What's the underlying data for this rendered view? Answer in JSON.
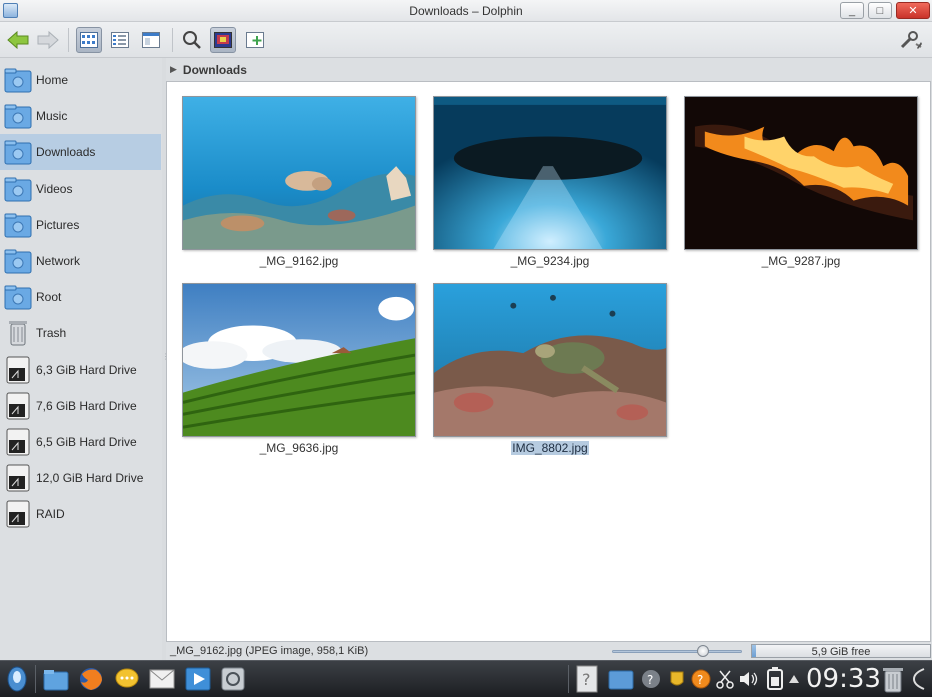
{
  "window": {
    "title": "Downloads – Dolphin",
    "min_label": "_",
    "max_label": "□",
    "close_label": "✕"
  },
  "toolbar": {
    "buttons": [
      {
        "name": "back-button",
        "icon": "back-arrow-icon"
      },
      {
        "name": "forward-button",
        "icon": "forward-arrow-icon"
      },
      {
        "name": "icons-view-button",
        "icon": "icons-view-icon",
        "active": true
      },
      {
        "name": "details-view-button",
        "icon": "details-view-icon"
      },
      {
        "name": "split-view-button",
        "icon": "split-view-icon"
      },
      {
        "name": "search-button",
        "icon": "search-icon"
      },
      {
        "name": "preview-button",
        "icon": "preview-icon",
        "active": true
      },
      {
        "name": "new-tab-button",
        "icon": "new-tab-icon"
      },
      {
        "name": "configure-button",
        "icon": "wrench-icon"
      }
    ]
  },
  "places": {
    "items": [
      {
        "label": "Home",
        "icon": "home-folder-icon"
      },
      {
        "label": "Music",
        "icon": "music-folder-icon"
      },
      {
        "label": "Downloads",
        "icon": "downloads-folder-icon",
        "selected": true
      },
      {
        "label": "Videos",
        "icon": "videos-folder-icon"
      },
      {
        "label": "Pictures",
        "icon": "pictures-folder-icon"
      },
      {
        "label": "Network",
        "icon": "network-folder-icon"
      },
      {
        "label": "Root",
        "icon": "root-folder-icon"
      },
      {
        "label": "Trash",
        "icon": "trash-icon"
      },
      {
        "label": "6,3 GiB Hard Drive",
        "icon": "hard-drive-icon"
      },
      {
        "label": "7,6 GiB Hard Drive",
        "icon": "hard-drive-icon"
      },
      {
        "label": "6,5 GiB Hard Drive",
        "icon": "hard-drive-icon"
      },
      {
        "label": "12,0 GiB Hard Drive",
        "icon": "hard-drive-icon"
      },
      {
        "label": "RAID",
        "icon": "hard-drive-icon"
      }
    ]
  },
  "breadcrumb": {
    "current": "Downloads"
  },
  "files": [
    {
      "name": "_MG_9162.jpg",
      "thumbnail": "underwater-cuttlefish"
    },
    {
      "name": "_MG_9234.jpg",
      "thumbnail": "boat-silhouette"
    },
    {
      "name": "_MG_9287.jpg",
      "thumbnail": "fire"
    },
    {
      "name": "_MG_9636.jpg",
      "thumbnail": "rice-terraces"
    },
    {
      "name": "IMG_8802.jpg",
      "thumbnail": "sea-turtle",
      "selected": true
    }
  ],
  "statusbar": {
    "info": "_MG_9162.jpg (JPEG image, 958,1 KiB)",
    "free_space": "5,9 GiB free",
    "zoom_level": 0.7,
    "disk_used_fraction": 0.02
  },
  "taskbar": {
    "clock": "09:33",
    "launchers": [
      "kde-menu-icon",
      "file-manager-icon",
      "firefox-icon",
      "chat-icon",
      "mail-icon",
      "media-player-icon",
      "system-settings-icon"
    ],
    "tray": [
      "help-icon",
      "folder-view-icon",
      "network-icon",
      "notification-icon",
      "updates-icon",
      "clipboard-icon",
      "volume-icon",
      "battery-icon",
      "tray-expand-icon",
      "trash-applet-icon",
      "plasma-cashew-icon"
    ]
  },
  "colors": {
    "selection": "#b7cde3",
    "accent": "#3d7cc9"
  }
}
